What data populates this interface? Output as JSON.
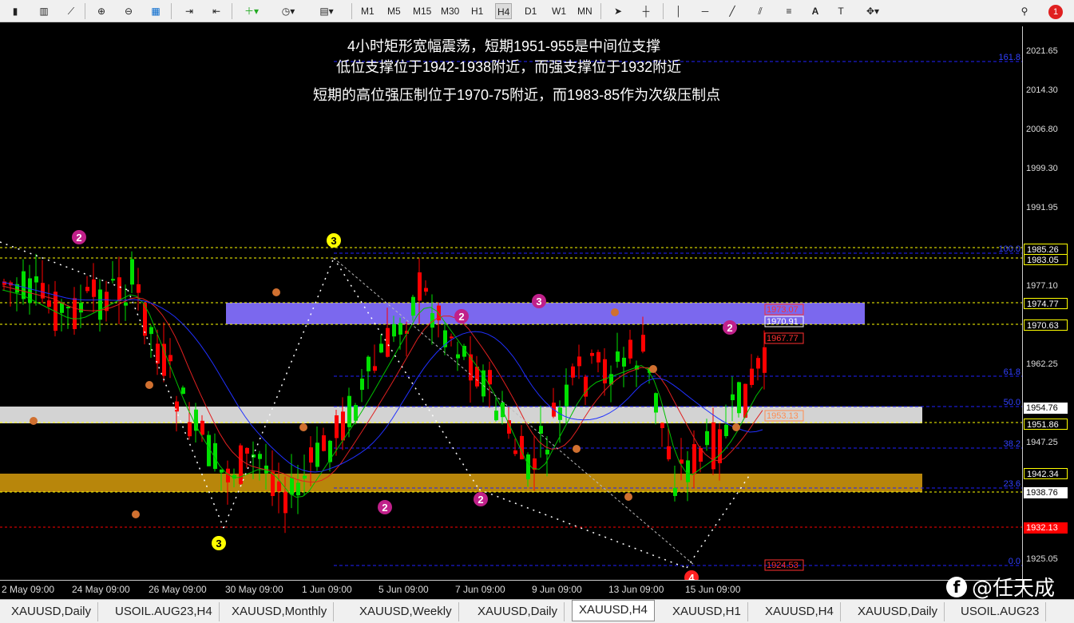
{
  "toolbar": {
    "timeframes": [
      "M1",
      "M5",
      "M15",
      "M30",
      "H1",
      "H4",
      "D1",
      "W1",
      "MN"
    ],
    "active_timeframe": "H4",
    "notification_count": "1"
  },
  "annotations": {
    "line1": "4小时矩形宽幅震荡，短期1951-955是中间位支撑",
    "line2": "低位支撑位于1942-1938附近，而强支撑位于1932附近",
    "line3": "短期的高位强压制位于1970-75附近，而1983-85作为次级压制点"
  },
  "price_axis": {
    "labels": [
      "2021.65",
      "2014.30",
      "2006.80",
      "1999.30",
      "1991.95",
      "1977.10",
      "1969.60",
      "1962.25",
      "1947.25",
      "1925.05"
    ],
    "boxes": [
      {
        "text": "1985.26",
        "bg": "#000000",
        "fg": "#ffffff"
      },
      {
        "text": "1983.05",
        "bg": "#000000",
        "fg": "#ffffff"
      },
      {
        "text": "1974.77",
        "bg": "#000000",
        "fg": "#ffffff"
      },
      {
        "text": "1970.63",
        "bg": "#000000",
        "fg": "#ffffff"
      },
      {
        "text": "1954.76",
        "bg": "#ffffff",
        "fg": "#000000"
      },
      {
        "text": "1951.86",
        "bg": "#000000",
        "fg": "#ffffff"
      },
      {
        "text": "1942.34",
        "bg": "#000000",
        "fg": "#ffffff"
      },
      {
        "text": "1938.76",
        "bg": "#ffffff",
        "fg": "#000000"
      },
      {
        "text": "1932.13",
        "bg": "#ff0000",
        "fg": "#ffffff"
      }
    ]
  },
  "fib_labels": [
    "161.8",
    "100.0",
    "61.8",
    "50.0",
    "38.2",
    "23.6",
    "0.0"
  ],
  "level_tags": [
    "1973.07",
    "1970.91",
    "1967.77",
    "1953.13",
    "1924.53"
  ],
  "wave_labels": [
    "2",
    "3",
    "3",
    "2",
    "2",
    "2",
    "3",
    "2",
    "3",
    "4"
  ],
  "time_axis": [
    "2 May 09:00",
    "24 May 09:00",
    "26 May 09:00",
    "30 May 09:00",
    "1 Jun 09:00",
    "5 Jun 09:00",
    "7 Jun 09:00",
    "9 Jun 09:00",
    "13 Jun 09:00",
    "15 Jun 09:00"
  ],
  "tabs": [
    "XAUUSD,Daily",
    "USOIL.AUG23,H4",
    "XAUUSD,Monthly",
    "XAUUSD,Weekly",
    "XAUUSD,Daily",
    "XAUUSD,H4",
    "XAUUSD,H1",
    "XAUUSD,H4",
    "XAUUSD,Daily",
    "USOIL.AUG23"
  ],
  "active_tab_index": 5,
  "watermark": "@任天成",
  "colors": {
    "bull": "#00e000",
    "bear": "#ff0000",
    "resistance_zone": "#7b68ee",
    "support_zone": "#b8860b",
    "middle_zone": "#d3d3d3"
  }
}
